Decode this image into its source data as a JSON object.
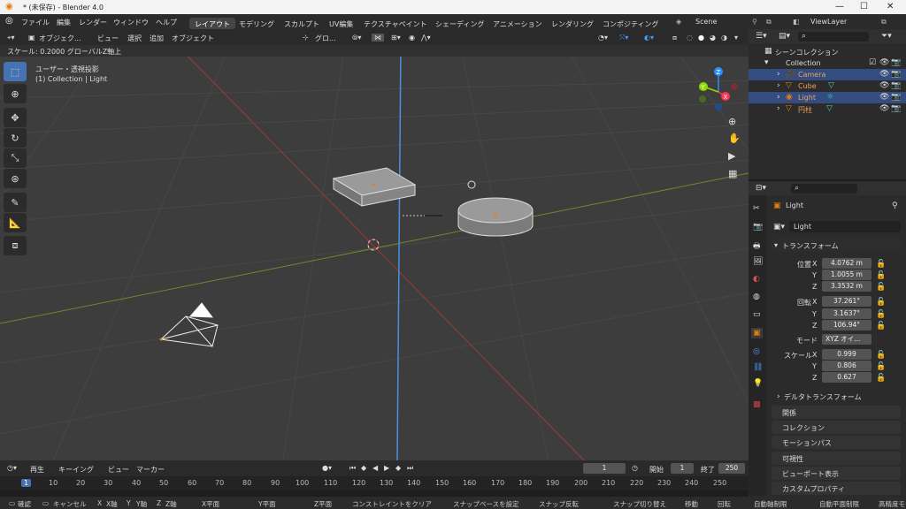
{
  "window": {
    "title": "* (未保存) - Blender 4.0"
  },
  "menu": [
    "ファイル",
    "編集",
    "レンダー",
    "ウィンドウ",
    "ヘルプ"
  ],
  "workspaces": [
    "レイアウト",
    "モデリング",
    "スカルプト",
    "UV編集",
    "テクスチャペイント",
    "シェーディング",
    "アニメーション",
    "レンダリング",
    "コンポジティング"
  ],
  "scene": "Scene",
  "view_layer": "ViewLayer",
  "header3d": {
    "mode": "オブジェク...",
    "view": "ビュー",
    "select": "選択",
    "add": "追加",
    "object": "オブジェクト",
    "transform": "グロ..."
  },
  "operator_status": "スケール: 0.2000 グローバルZ軸上",
  "viewport": {
    "view_name": "ユーザー・透視投影",
    "context": "(1) Collection | Light"
  },
  "outliner": {
    "scene_collection": "シーンコレクション",
    "collection": "Collection",
    "items": [
      "Camera",
      "Cube",
      "Light",
      "円柱"
    ]
  },
  "properties": {
    "object_name": "Light",
    "data_name": "Light",
    "transform": "トランスフォーム",
    "location_label": "位置",
    "rotation_label": "回転",
    "scale_label": "スケール",
    "mode_label": "モード",
    "axes": [
      "X",
      "Y",
      "Z"
    ],
    "location": [
      "4.0762 m",
      "1.0055 m",
      "3.3532 m"
    ],
    "rotation": [
      "37.261°",
      "3.1637°",
      "106.94°"
    ],
    "mode": "XYZ オイ...",
    "scale": [
      "0.999",
      "0.806",
      "0.627"
    ],
    "delta": "デルタトランスフォーム",
    "sections": [
      "関係",
      "コレクション",
      "モーションパス",
      "可視性",
      "ビューポート表示",
      "カスタムプロパティ"
    ]
  },
  "timeline": {
    "playback": "再生",
    "keying": "キーイング",
    "view": "ビュー",
    "marker": "マーカー",
    "current": "1",
    "start_label": "開始",
    "start": "1",
    "end_label": "終了",
    "end": "250"
  },
  "ruler": [
    "1",
    "10",
    "20",
    "30",
    "40",
    "50",
    "60",
    "70",
    "80",
    "90",
    "100",
    "110",
    "120",
    "130",
    "140",
    "150",
    "160",
    "170",
    "180",
    "190",
    "200",
    "210",
    "220",
    "230",
    "240",
    "250"
  ],
  "status": [
    "確認",
    "キャンセル",
    "X軸",
    "Y軸",
    "Z軸",
    "X平面",
    "Y平面",
    "Z平面",
    "コンストレイントをクリア",
    "スナップベースを設定",
    "スナップ反転",
    "スナップ切り替え",
    "移動",
    "回転",
    "自動軸制限",
    "自動平面制限",
    "高精度モード"
  ],
  "colors": {
    "accent": "#4772b3",
    "x_axis": "#ff3352",
    "y_axis": "#8bdc00",
    "z_axis": "#2890ff"
  }
}
